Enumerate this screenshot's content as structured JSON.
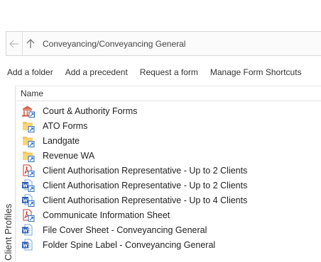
{
  "address": {
    "back_icon": "arrow-left-icon",
    "up_icon": "arrow-up-icon",
    "path": "Conveyancing/Conveyancing General"
  },
  "toolbar": {
    "items": [
      {
        "label": "Add a folder"
      },
      {
        "label": "Add a precedent"
      },
      {
        "label": "Request a form"
      },
      {
        "label": "Manage Form Shortcuts"
      }
    ]
  },
  "sidebar": {
    "label": "Client Profiles"
  },
  "list": {
    "column_header": "Name",
    "rows": [
      {
        "label": "Court & Authority Forms",
        "icon": "building-shortcut-icon"
      },
      {
        "label": "ATO Forms",
        "icon": "folder-shortcut-icon"
      },
      {
        "label": "Landgate",
        "icon": "folder-shortcut-icon"
      },
      {
        "label": "Revenue WA",
        "icon": "folder-shortcut-icon"
      },
      {
        "label": "Client Authorisation Representative - Up to 2 Clients",
        "icon": "pdf-shortcut-icon"
      },
      {
        "label": "Client Authorisation Representative - Up to 2 Clients",
        "icon": "word-shortcut-icon"
      },
      {
        "label": "Client Authorisation Representative - Up to 4 Clients",
        "icon": "word-shortcut-icon"
      },
      {
        "label": "Communicate Information Sheet",
        "icon": "pdf-shortcut-icon"
      },
      {
        "label": "File Cover Sheet - Conveyancing General",
        "icon": "word-doc-icon"
      },
      {
        "label": "Folder Spine Label - Conveyancing General",
        "icon": "word-doc-icon"
      }
    ]
  }
}
